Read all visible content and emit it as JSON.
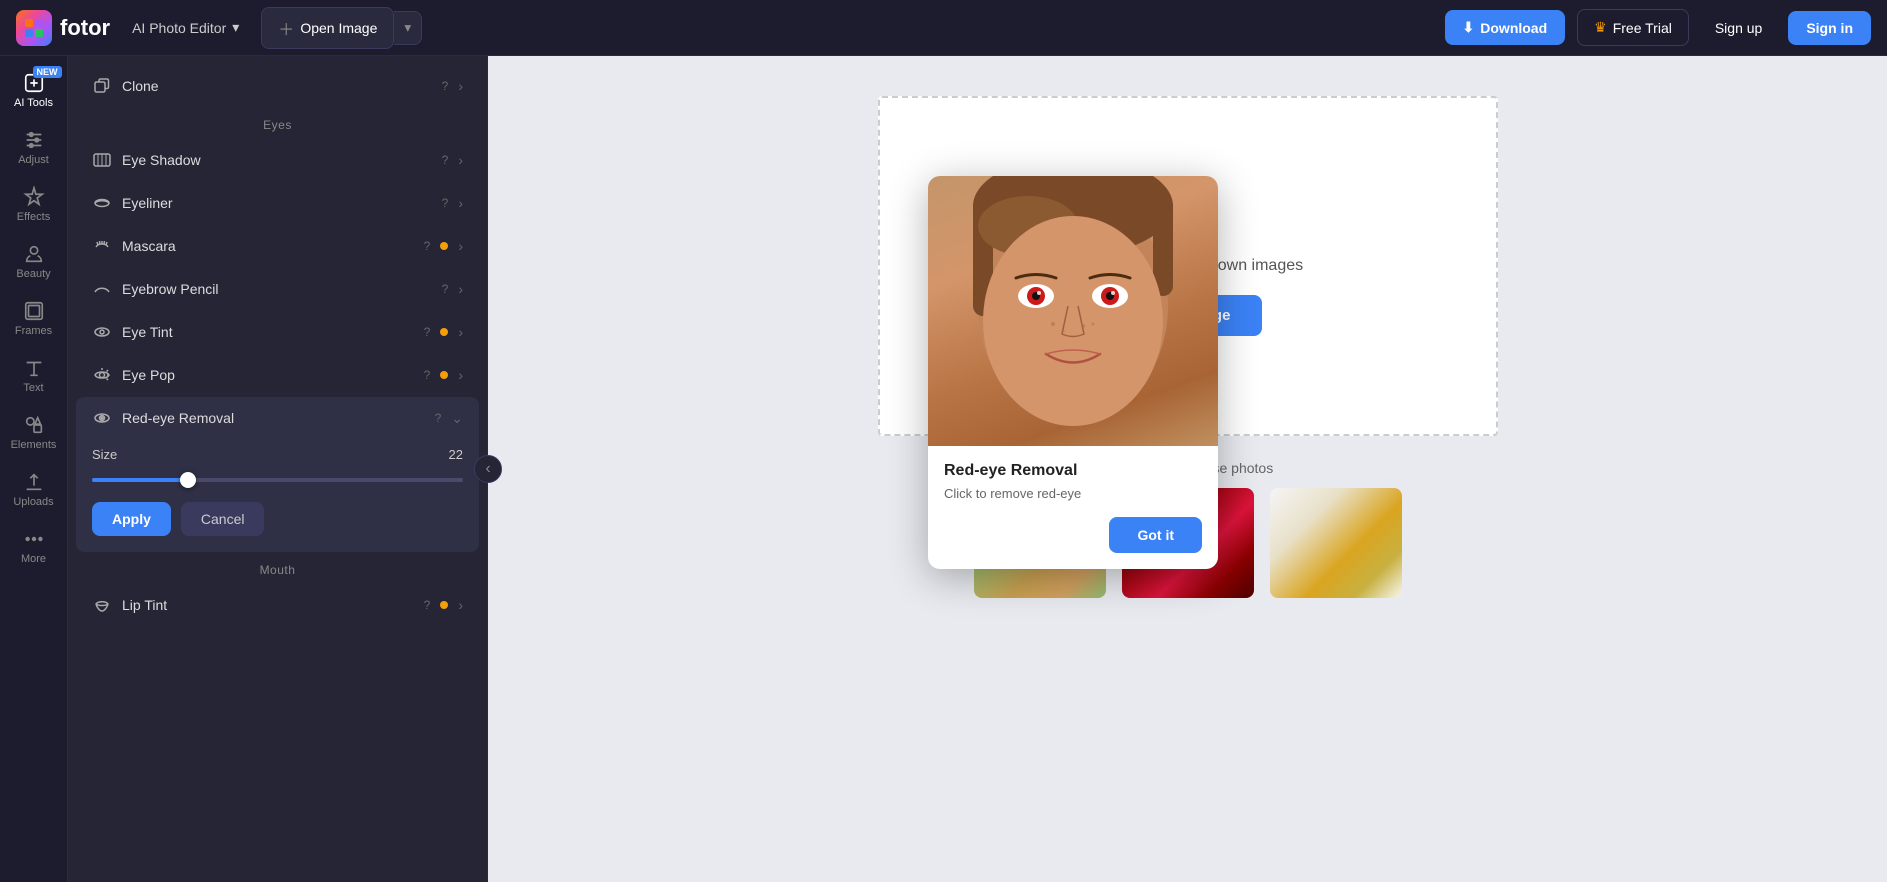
{
  "app": {
    "logo_text": "fotor",
    "ai_editor_label": "AI Photo Editor",
    "open_image_label": "Open Image",
    "download_label": "Download",
    "free_trial_label": "Free Trial",
    "signup_label": "Sign up",
    "signin_label": "Sign in"
  },
  "icon_sidebar": {
    "items": [
      {
        "id": "ai-tools",
        "label": "AI Tools",
        "has_new": true
      },
      {
        "id": "adjust",
        "label": "Adjust"
      },
      {
        "id": "effects",
        "label": "Effects"
      },
      {
        "id": "beauty",
        "label": "Beauty"
      },
      {
        "id": "frames",
        "label": "Frames"
      },
      {
        "id": "text",
        "label": "Text"
      },
      {
        "id": "elements",
        "label": "Elements"
      },
      {
        "id": "uploads",
        "label": "Uploads"
      },
      {
        "id": "more",
        "label": "More"
      }
    ]
  },
  "panel": {
    "clone_label": "Clone",
    "eyes_section": "Eyes",
    "items": [
      {
        "id": "eye-shadow",
        "label": "Eye Shadow",
        "has_dot": false
      },
      {
        "id": "eyeliner",
        "label": "Eyeliner",
        "has_dot": false
      },
      {
        "id": "mascara",
        "label": "Mascara",
        "has_dot": true
      },
      {
        "id": "eyebrow-pencil",
        "label": "Eyebrow Pencil",
        "has_dot": false
      },
      {
        "id": "eye-tint",
        "label": "Eye Tint",
        "has_dot": true
      },
      {
        "id": "eye-pop",
        "label": "Eye Pop",
        "has_dot": true
      }
    ],
    "expanded_item": {
      "id": "red-eye-removal",
      "label": "Red-eye Removal",
      "size_label": "Size",
      "size_value": 22,
      "slider_percent": 28
    },
    "mouth_section": "Mouth",
    "mouth_items": [
      {
        "id": "lip-tint",
        "label": "Lip Tint",
        "has_dot": true
      }
    ],
    "apply_label": "Apply",
    "cancel_label": "Cancel"
  },
  "canvas": {
    "drag_text": "Drag or upload your own images",
    "open_image_label": "Open Image",
    "try_text": "Try the ready-to-use photos"
  },
  "popup": {
    "title": "Red-eye Removal",
    "description": "Click to remove red-eye",
    "got_it_label": "Got it"
  }
}
